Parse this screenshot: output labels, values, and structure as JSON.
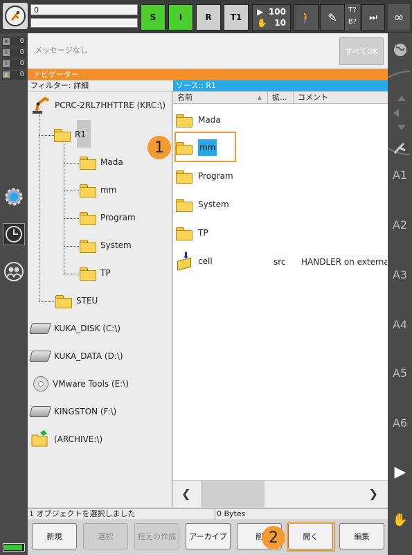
{
  "topbar": {
    "program_line1": "0",
    "status_s": "S",
    "status_i": "I",
    "status_r": "R",
    "mode": "T1",
    "override_top": "100",
    "override_bottom": "10",
    "tq_top": "T?",
    "tq_bottom": "B?",
    "infinity": "∞"
  },
  "left": {
    "counters": [
      "0",
      "0",
      "0",
      "0"
    ]
  },
  "message": {
    "text": "メッセージなし",
    "all_ok_label": "すべてOK"
  },
  "navigator": {
    "title": "ナビゲーター",
    "filter": "フィルター: 詳細",
    "source": "ソース:: R1"
  },
  "tree": {
    "root": "PCRC-2RL7HHTTRE (KRC:\\)",
    "r1": "R1",
    "children": [
      "Mada",
      "mm",
      "Program",
      "System",
      "TP"
    ],
    "steu": "STEU",
    "drives": [
      "KUKA_DISK (C:\\)",
      "KUKA_DATA (D:\\)",
      "VMware Tools (E:\\)",
      "KINGSTON (F:\\)",
      "(ARCHIVE:\\)"
    ]
  },
  "list": {
    "headers": {
      "name": "名前",
      "ext": "拡...",
      "comment": "コメント"
    },
    "folders": [
      "Mada",
      "mm",
      "Program",
      "System",
      "TP"
    ],
    "file": {
      "name": "cell",
      "ext": "src",
      "comment": "HANDLER on external ..."
    }
  },
  "status": {
    "selected": "1 オブジェクトを選択しました",
    "size": "0 Bytes"
  },
  "buttons": {
    "new": "新規",
    "select": "選択",
    "duplicate": "控えの作成",
    "archive": "アーカイブ",
    "delete": "削",
    "open": "開く",
    "edit": "編集"
  },
  "axes": [
    "A1",
    "A2",
    "A3",
    "A4",
    "A5",
    "A6"
  ],
  "markers": [
    "1",
    "2"
  ],
  "colors": {
    "accent_orange": "#f28f2b",
    "selection_blue": "#29a9e8",
    "status_green": "#4ccf2e"
  }
}
